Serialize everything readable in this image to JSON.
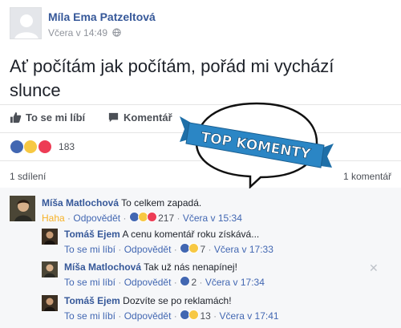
{
  "post": {
    "author": "Míla Ema Patzeltová",
    "time": "Včera v 14:49",
    "text": "Ať počítám jak počítám, pořád mi vychází slunce"
  },
  "actions": {
    "like": "To se mi líbí",
    "comment": "Komentář"
  },
  "reactions": {
    "count": "183"
  },
  "stats": {
    "shares": "1 sdílení",
    "comments": "1 komentář"
  },
  "badge": {
    "text": "TOP KOMENTY"
  },
  "comments": [
    {
      "name": "Míša Matlochová",
      "text": "To celkem zapadá.",
      "reaction_label": "Haha",
      "reply": "Odpovědět",
      "count": "217",
      "time": "Včera v 15:34"
    },
    {
      "name": "Tomáš Ejem",
      "text": "A cenu komentář roku získává...",
      "like": "To se mi líbí",
      "reply": "Odpovědět",
      "count": "7",
      "time": "Včera v 17:33"
    },
    {
      "name": "Míša Matlochová",
      "text": "Tak už nás nenapínej!",
      "like": "To se mi líbí",
      "reply": "Odpovědět",
      "count": "2",
      "time": "Včera v 17:34"
    },
    {
      "name": "Tomáš Ejem",
      "text": "Dozvíte se po reklamách!",
      "like": "To se mi líbí",
      "reply": "Odpovědět",
      "count": "13",
      "time": "Včera v 17:41"
    }
  ],
  "separator": "·",
  "colors": {
    "link": "#365899",
    "like": "#4267b2",
    "haha": "#f7b125",
    "love": "#ed3c55",
    "badge": "#2b86c5"
  },
  "icons": [
    "default-avatar-icon",
    "globe-icon",
    "thumbs-up-icon",
    "comment-icon",
    "like-reaction-icon",
    "haha-reaction-icon",
    "love-reaction-icon",
    "close-icon",
    "speech-bubble-badge"
  ]
}
